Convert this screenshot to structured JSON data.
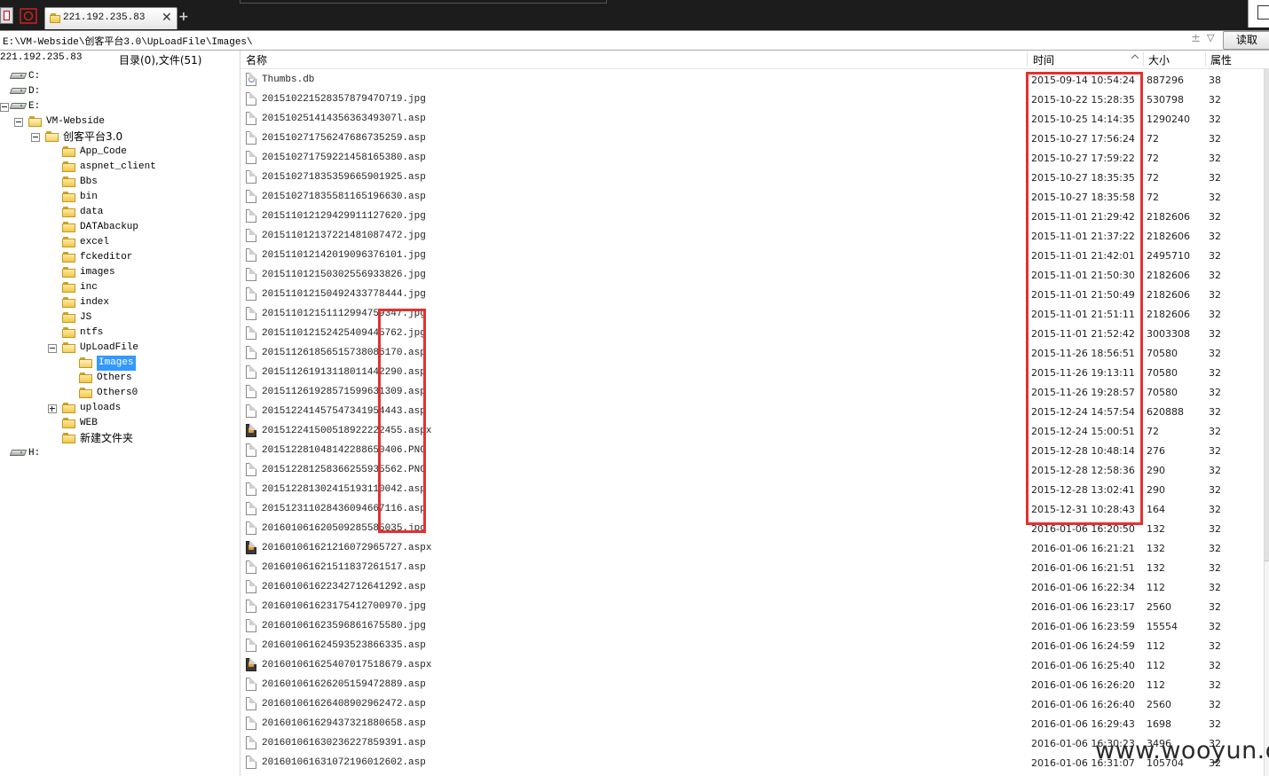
{
  "tab": {
    "title": "221.192.235.83"
  },
  "address": {
    "path": "E:\\VM-Webside\\创客平台3.0\\UpLoadFile\\Images\\",
    "read_label": "读取"
  },
  "tree": {
    "host": "221.192.235.83",
    "stats": "目录(0),文件(51)",
    "nodes": [
      {
        "label": "C:",
        "type": "drive",
        "depth": 0,
        "expander": ""
      },
      {
        "label": "D:",
        "type": "drive",
        "depth": 0,
        "expander": ""
      },
      {
        "label": "E:",
        "type": "drive",
        "depth": 0,
        "expander": "minus"
      },
      {
        "label": "VM-Webside",
        "type": "folder",
        "depth": 1,
        "expander": "minus"
      },
      {
        "label": "创客平台3.0",
        "type": "folder",
        "depth": 2,
        "expander": "minus"
      },
      {
        "label": "App_Code",
        "type": "folder",
        "depth": 3,
        "expander": ""
      },
      {
        "label": "aspnet_client",
        "type": "folder",
        "depth": 3,
        "expander": ""
      },
      {
        "label": "Bbs",
        "type": "folder",
        "depth": 3,
        "expander": ""
      },
      {
        "label": "bin",
        "type": "folder",
        "depth": 3,
        "expander": ""
      },
      {
        "label": "data",
        "type": "folder",
        "depth": 3,
        "expander": ""
      },
      {
        "label": "DATAbackup",
        "type": "folder",
        "depth": 3,
        "expander": ""
      },
      {
        "label": "excel",
        "type": "folder",
        "depth": 3,
        "expander": ""
      },
      {
        "label": "fckeditor",
        "type": "folder",
        "depth": 3,
        "expander": ""
      },
      {
        "label": "images",
        "type": "folder",
        "depth": 3,
        "expander": ""
      },
      {
        "label": "inc",
        "type": "folder",
        "depth": 3,
        "expander": ""
      },
      {
        "label": "index",
        "type": "folder",
        "depth": 3,
        "expander": ""
      },
      {
        "label": "JS",
        "type": "folder",
        "depth": 3,
        "expander": ""
      },
      {
        "label": "ntfs",
        "type": "folder",
        "depth": 3,
        "expander": ""
      },
      {
        "label": "UpLoadFile",
        "type": "folder",
        "depth": 3,
        "expander": "minus"
      },
      {
        "label": "Images",
        "type": "folder",
        "depth": 4,
        "expander": "",
        "selected": true
      },
      {
        "label": "Others",
        "type": "folder",
        "depth": 4,
        "expander": ""
      },
      {
        "label": "Others0",
        "type": "folder",
        "depth": 4,
        "expander": ""
      },
      {
        "label": "uploads",
        "type": "folder",
        "depth": 3,
        "expander": "plus"
      },
      {
        "label": "WEB",
        "type": "folder",
        "depth": 3,
        "expander": ""
      },
      {
        "label": "新建文件夹",
        "type": "folder",
        "depth": 3,
        "expander": ""
      },
      {
        "label": "H:",
        "type": "drive",
        "depth": 0,
        "expander": ""
      }
    ]
  },
  "columns": {
    "name": "名称",
    "time": "时间",
    "size": "大小",
    "attr": "属性"
  },
  "files": [
    {
      "name": "Thumbs.db",
      "time": "2015-09-14 10:54:24",
      "size": "887296",
      "attr": "38",
      "icon": "db"
    },
    {
      "name": "20151022152835787947O719.jpg",
      "time": "2015-10-22 15:28:35",
      "size": "530798",
      "attr": "32",
      "icon": "file"
    },
    {
      "name": "20151025141435636349307l.asp",
      "time": "2015-10-25 14:14:35",
      "size": "1290240",
      "attr": "32",
      "icon": "file"
    },
    {
      "name": "20151027175624768673525​9.asp",
      "time": "2015-10-27 17:56:24",
      "size": "72",
      "attr": "32",
      "icon": "file"
    },
    {
      "name": "2015102717592214581653​80.asp",
      "time": "2015-10-27 17:59:22",
      "size": "72",
      "attr": "32",
      "icon": "file"
    },
    {
      "name": "20151027183535966590192​5.asp",
      "time": "2015-10-27 18:35:35",
      "size": "72",
      "attr": "32",
      "icon": "file"
    },
    {
      "name": "2015102718355811651966​30.asp",
      "time": "2015-10-27 18:35:58",
      "size": "72",
      "attr": "32",
      "icon": "file"
    },
    {
      "name": "2015110121294299111276​20.jpg",
      "time": "2015-11-01 21:29:42",
      "size": "2182606",
      "attr": "32",
      "icon": "file"
    },
    {
      "name": "2015110121372214810874​72.jpg",
      "time": "2015-11-01 21:37:22",
      "size": "2182606",
      "attr": "32",
      "icon": "file"
    },
    {
      "name": "2015110121420190963761​01.jpg",
      "time": "2015-11-01 21:42:01",
      "size": "2495710",
      "attr": "32",
      "icon": "file"
    },
    {
      "name": "2015110121503025569338​26.jpg",
      "time": "2015-11-01 21:50:30",
      "size": "2182606",
      "attr": "32",
      "icon": "file"
    },
    {
      "name": "2015110121504924337784​44.jpg",
      "time": "2015-11-01 21:50:49",
      "size": "2182606",
      "attr": "32",
      "icon": "file"
    },
    {
      "name": "2015110121511129947593​47.jpg",
      "time": "2015-11-01 21:51:11",
      "size": "2182606",
      "attr": "32",
      "icon": "file"
    },
    {
      "name": "2015110121524254094457​62.jpg",
      "time": "2015-11-01 21:52:42",
      "size": "3003308",
      "attr": "32",
      "icon": "file"
    },
    {
      "name": "2015112618565157380861​70.asp",
      "time": "2015-11-26 18:56:51",
      "size": "70580",
      "attr": "32",
      "icon": "file"
    },
    {
      "name": "2015112619131180114422​90.asp",
      "time": "2015-11-26 19:13:11",
      "size": "70580",
      "attr": "32",
      "icon": "file"
    },
    {
      "name": "2015112619285715996313​09.asp",
      "time": "2015-11-26 19:28:57",
      "size": "70580",
      "attr": "32",
      "icon": "file"
    },
    {
      "name": "2015122414575473419544​43.asp",
      "time": "2015-12-24 14:57:54",
      "size": "620888",
      "attr": "32",
      "icon": "file"
    },
    {
      "name": "2015122415005189222224​55.aspx",
      "time": "2015-12-24 15:00:51",
      "size": "72",
      "attr": "32",
      "icon": "aspx"
    },
    {
      "name": "2015122810481422886504​06.PNG",
      "time": "2015-12-28 10:48:14",
      "size": "276",
      "attr": "32",
      "icon": "file"
    },
    {
      "name": "2015122812583662559355​62.PNG",
      "time": "2015-12-28 12:58:36",
      "size": "290",
      "attr": "32",
      "icon": "file"
    },
    {
      "name": "2015122813024151931100​42.asp",
      "time": "2015-12-28 13:02:41",
      "size": "290",
      "attr": "32",
      "icon": "file"
    },
    {
      "name": "2015123110284360946671​16.asp",
      "time": "2015-12-31 10:28:43",
      "size": "164",
      "attr": "32",
      "icon": "file"
    },
    {
      "name": "2016010616205092855850​35.jpg",
      "time": "2016-01-06 16:20:50",
      "size": "132",
      "attr": "32",
      "icon": "file"
    },
    {
      "name": "20160106162121607296572​7.aspx",
      "time": "2016-01-06 16:21:21",
      "size": "132",
      "attr": "32",
      "icon": "aspx"
    },
    {
      "name": "20160106162151183726151​7.asp",
      "time": "2016-01-06 16:21:51",
      "size": "132",
      "attr": "32",
      "icon": "file"
    },
    {
      "name": "20160106162234271264129​2.asp",
      "time": "2016-01-06 16:22:34",
      "size": "112",
      "attr": "32",
      "icon": "file"
    },
    {
      "name": "20160106162317541270097​0.jpg",
      "time": "2016-01-06 16:23:17",
      "size": "2560",
      "attr": "32",
      "icon": "file"
    },
    {
      "name": "20160106162359686167558​0.jpg",
      "time": "2016-01-06 16:23:59",
      "size": "15554",
      "attr": "32",
      "icon": "file"
    },
    {
      "name": "20160106162459352386633​5.asp",
      "time": "2016-01-06 16:24:59",
      "size": "112",
      "attr": "32",
      "icon": "file"
    },
    {
      "name": "20160106162540701751867​9.aspx",
      "time": "2016-01-06 16:25:40",
      "size": "112",
      "attr": "32",
      "icon": "aspx"
    },
    {
      "name": "20160106162620515947288​9.asp",
      "time": "2016-01-06 16:26:20",
      "size": "112",
      "attr": "32",
      "icon": "file"
    },
    {
      "name": "20160106162640890296247​2.asp",
      "time": "2016-01-06 16:26:40",
      "size": "2560",
      "attr": "32",
      "icon": "file"
    },
    {
      "name": "20160106162943732188065​8.asp",
      "time": "2016-01-06 16:29:43",
      "size": "1698",
      "attr": "32",
      "icon": "file"
    },
    {
      "name": "20160106163023622785939​1.asp",
      "time": "2016-01-06 16:30:23",
      "size": "3496",
      "attr": "32",
      "icon": "file"
    },
    {
      "name": "20160106163107219601260​2.asp",
      "time": "2016-01-06 16:31:07",
      "size": "105704",
      "attr": "32",
      "icon": "file"
    }
  ],
  "watermark": "www.wooyun.org"
}
